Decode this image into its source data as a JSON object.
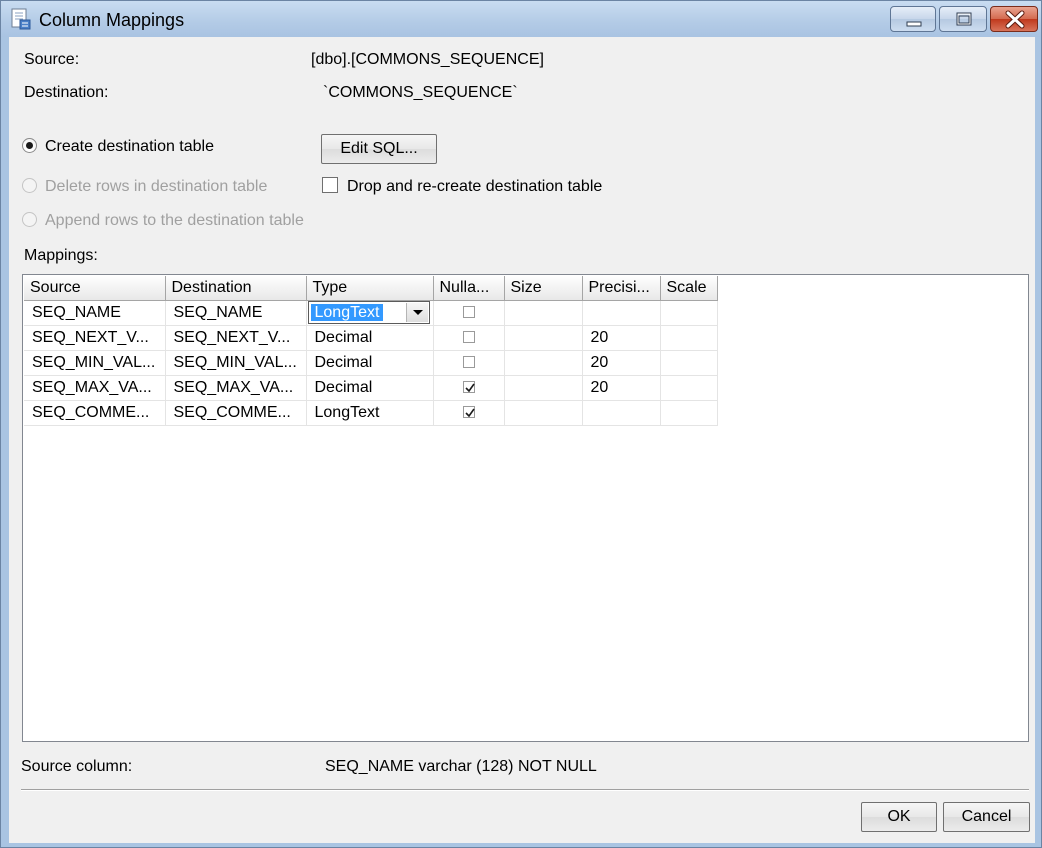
{
  "window": {
    "title": "Column Mappings"
  },
  "source": {
    "label": "Source:",
    "value": "[dbo].[COMMONS_SEQUENCE]"
  },
  "destination": {
    "label": "Destination:",
    "value": "`COMMONS_SEQUENCE`"
  },
  "options": {
    "create_table": "Create destination table",
    "delete_rows": "Delete rows in destination table",
    "append_rows": "Append rows to the destination table",
    "edit_sql": "Edit SQL...",
    "drop_recreate": "Drop and re-create destination table"
  },
  "mappings": {
    "label": "Mappings:",
    "columns": [
      "Source",
      "Destination",
      "Type",
      "Nulla...",
      "Size",
      "Precisi...",
      "Scale"
    ],
    "rows": [
      {
        "source": "SEQ_NAME",
        "destination": "SEQ_NAME",
        "type": "LongText",
        "nullable": false,
        "size": "",
        "precision": "",
        "scale": ""
      },
      {
        "source": "SEQ_NEXT_V...",
        "destination": "SEQ_NEXT_V...",
        "type": "Decimal",
        "nullable": false,
        "size": "",
        "precision": "20",
        "scale": ""
      },
      {
        "source": "SEQ_MIN_VAL...",
        "destination": "SEQ_MIN_VAL...",
        "type": "Decimal",
        "nullable": false,
        "size": "",
        "precision": "20",
        "scale": ""
      },
      {
        "source": "SEQ_MAX_VA...",
        "destination": "SEQ_MAX_VA...",
        "type": "Decimal",
        "nullable": true,
        "size": "",
        "precision": "20",
        "scale": ""
      },
      {
        "source": "SEQ_COMME...",
        "destination": "SEQ_COMME...",
        "type": "LongText",
        "nullable": true,
        "size": "",
        "precision": "",
        "scale": ""
      }
    ]
  },
  "source_column": {
    "label": "Source column:",
    "value": "SEQ_NAME varchar (128) NOT NULL"
  },
  "buttons": {
    "ok": "OK",
    "cancel": "Cancel"
  }
}
